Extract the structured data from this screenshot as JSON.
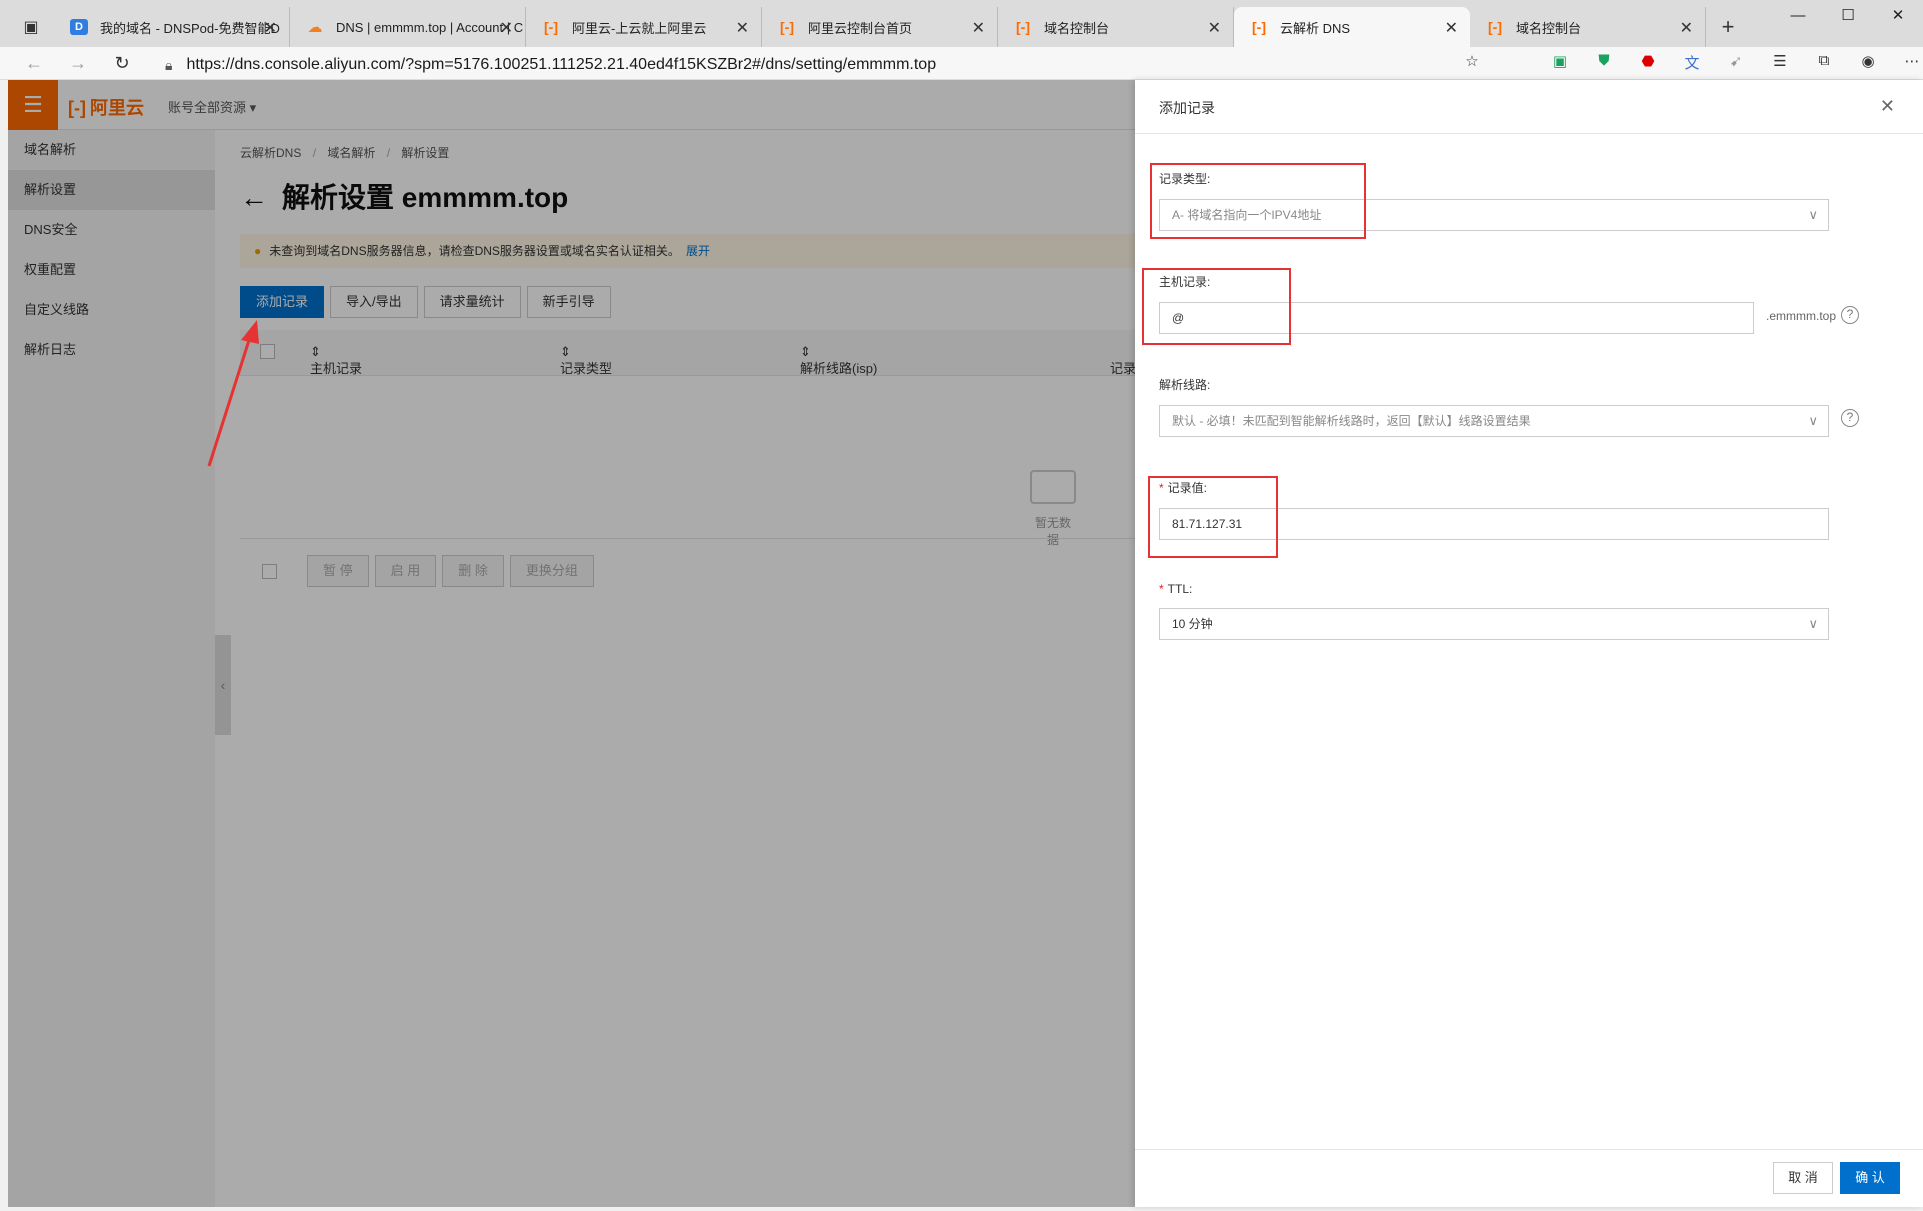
{
  "browser": {
    "tabs": [
      {
        "title": "我的域名 - DNSPod-免费智能D",
        "favicon": "dnspod-icon"
      },
      {
        "title": "DNS | emmmm.top | Account | C",
        "favicon": "cloudflare-icon"
      },
      {
        "title": "阿里云-上云就上阿里云",
        "favicon": "aliyun-icon"
      },
      {
        "title": "阿里云控制台首页",
        "favicon": "aliyun-icon"
      },
      {
        "title": "域名控制台",
        "favicon": "aliyun-icon"
      },
      {
        "title": "云解析 DNS",
        "favicon": "aliyun-icon",
        "active": true
      },
      {
        "title": "域名控制台",
        "favicon": "aliyun-icon"
      }
    ],
    "url": "https://dns.console.aliyun.com/?spm=5176.100251.111252.21.40ed4f15KSZBr2#/dns/setting/emmmm.top"
  },
  "app": {
    "logo": "阿里云",
    "resources": "账号全部资源",
    "sidebar": [
      {
        "label": "域名解析"
      },
      {
        "label": "解析设置",
        "active": true
      },
      {
        "label": "DNS安全"
      },
      {
        "label": "权重配置"
      },
      {
        "label": "自定义线路"
      },
      {
        "label": "解析日志"
      }
    ],
    "breadcrumb": [
      "云解析DNS",
      "域名解析",
      "解析设置"
    ],
    "page_title": "解析设置 emmmm.top",
    "notice": "未查询到域名DNS服务器信息，请检查DNS服务器设置或域名实名认证相关。",
    "notice_link": "展开",
    "buttons": [
      "添加记录",
      "导入/导出",
      "请求量统计",
      "新手引导"
    ],
    "columns": [
      "主机记录",
      "记录类型",
      "解析线路(isp)",
      "记录值"
    ],
    "empty_text": "暂无数据",
    "bulk_buttons": [
      "暂 停",
      "启 用",
      "删 除",
      "更换分组"
    ]
  },
  "drawer": {
    "title": "添加记录",
    "record_type_label": "记录类型:",
    "record_type_value": "A- 将域名指向一个IPV4地址",
    "host_label": "主机记录:",
    "host_value": "@",
    "host_suffix": ".emmmm.top",
    "line_label": "解析线路:",
    "line_value": "默认 - 必填！未匹配到智能解析线路时，返回【默认】线路设置结果",
    "value_label": "记录值:",
    "value_value": "81.71.127.31",
    "ttl_label": "TTL:",
    "ttl_value": "10 分钟",
    "cancel": "取 消",
    "confirm": "确 认"
  },
  "colors": {
    "brand": "#ff6a00",
    "primary": "#0070cc",
    "annotation": "#e53333"
  }
}
